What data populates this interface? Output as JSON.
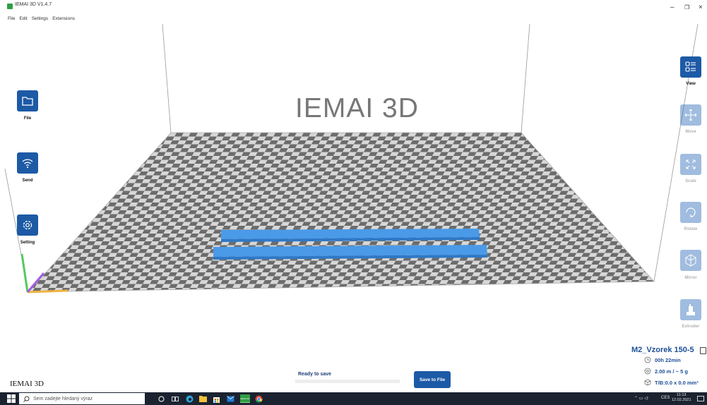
{
  "window": {
    "title": "IEMAI 3D V1.4.7",
    "minimize_glyph": "–",
    "restore_glyph": "❐",
    "close_glyph": "×"
  },
  "menu": [
    "File",
    "Edit",
    "Settings",
    "Extensions"
  ],
  "viewport": {
    "brand_text": "IEMAI 3D"
  },
  "left_tools": [
    {
      "label": "File",
      "icon": "folder-icon"
    },
    {
      "label": "Send",
      "icon": "wifi-icon"
    },
    {
      "label": "Setting",
      "icon": "gear-icon"
    }
  ],
  "right_tools": [
    {
      "label": "View",
      "icon": "view-list-icon",
      "enabled": true
    },
    {
      "label": "Move",
      "icon": "move-arrows-icon",
      "enabled": false
    },
    {
      "label": "Scale",
      "icon": "scale-arrows-icon",
      "enabled": false
    },
    {
      "label": "Rotate",
      "icon": "rotate-icon",
      "enabled": false
    },
    {
      "label": "Mirror",
      "icon": "mirror-cube-icon",
      "enabled": false
    },
    {
      "label": "Extruder",
      "icon": "extruder-icon",
      "enabled": false
    }
  ],
  "model_info": {
    "name": "M2_Vzorek 150-5",
    "print_time": "00h 22min",
    "material": "2.00 m / ~ 5 g",
    "dimensions": "T/B:0.0 x 0.0 mm³"
  },
  "bottom": {
    "brand": "IEMAI 3D",
    "status": "Ready to save",
    "progress": 0,
    "save_label": "Save to File"
  },
  "taskbar": {
    "search_placeholder": "Sem zadejte hledaný výraz",
    "pinned_app_label": "IEMAI 3D",
    "language": "CES",
    "time": "11:13",
    "date": "12.02.2021"
  },
  "colors": {
    "accent": "#1d5aa6",
    "model_blue": "#4a9ae8",
    "taskbar": "#1b2330",
    "info_text": "#1d4f98"
  }
}
